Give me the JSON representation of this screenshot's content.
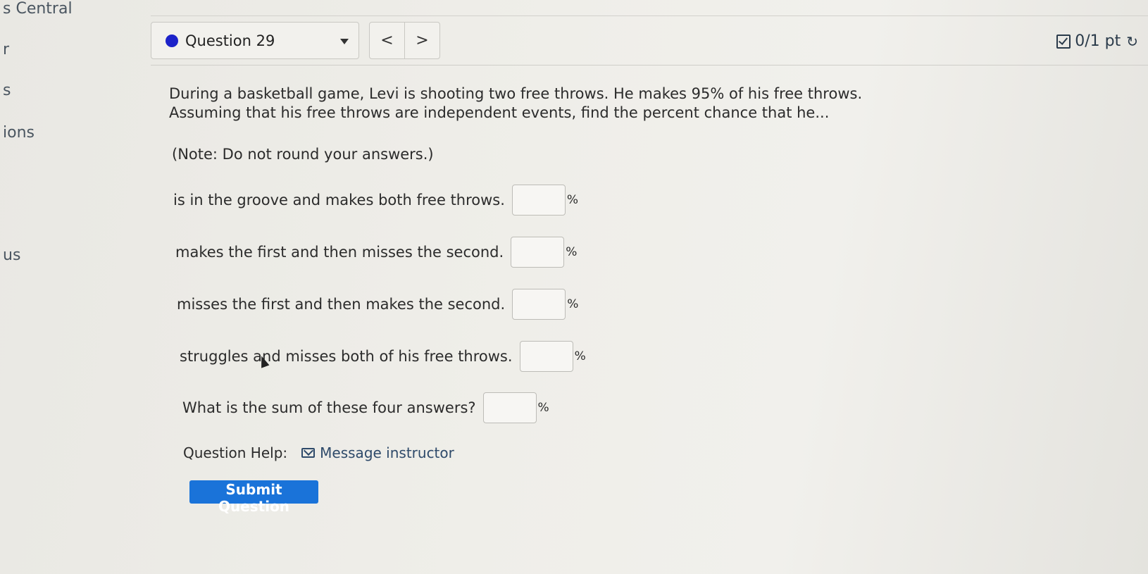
{
  "sidebar": {
    "items": [
      "s Central",
      "r",
      "s",
      "ions",
      "us"
    ]
  },
  "question_nav": {
    "selected": "Question 29",
    "prev_glyph": "<",
    "next_glyph": ">"
  },
  "score": {
    "text": "0/1 pt"
  },
  "question": {
    "problem_text": "During a basketball game, Levi is shooting two free throws. He makes 95% of his free throws. Assuming that his free throws are independent events, find the percent chance that he...",
    "note": "(Note: Do not round your answers.)",
    "rows": [
      {
        "label": "is in the groove and makes both free throws.",
        "value": "",
        "unit": "%"
      },
      {
        "label": "makes the first and then misses the second.",
        "value": "",
        "unit": "%"
      },
      {
        "label": "misses the first and then makes the second.",
        "value": "",
        "unit": "%"
      },
      {
        "label": "struggles and misses both of his free throws.",
        "value": "",
        "unit": "%"
      },
      {
        "label": "What is the sum of these four answers?",
        "value": "",
        "unit": "%"
      }
    ]
  },
  "help": {
    "label": "Question Help:",
    "link": "Message instructor"
  },
  "submit_label": "Submit Question",
  "colors": {
    "accent": "#1a73d9",
    "dot": "#1c22c9"
  }
}
